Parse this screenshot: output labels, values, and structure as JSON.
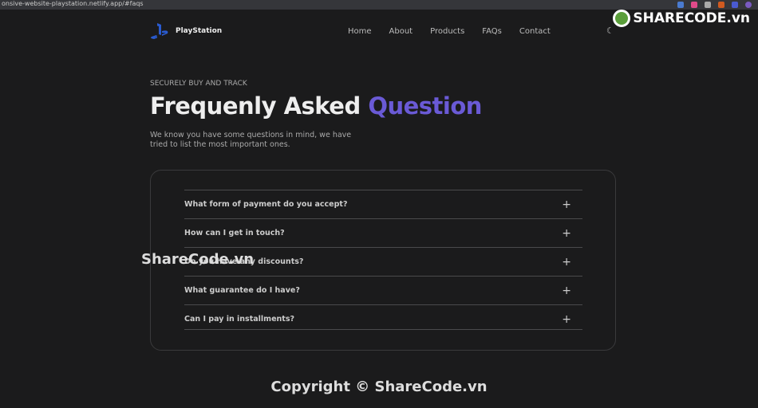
{
  "browser": {
    "url": "onsive-website-playstation.netlify.app/#faqs"
  },
  "nav": {
    "logo": "PlayStation",
    "items": [
      "Home",
      "About",
      "Products",
      "FAQs",
      "Contact"
    ],
    "theme_icon": "moon-icon"
  },
  "brand_watermark": "SHARECODE.vn",
  "hero": {
    "eyebrow": "SECURELY BUY AND TRACK",
    "title": "Frequenly Asked ",
    "title_accent": "Question",
    "accent_color": "#6a5ad6",
    "description": "We know you have some questions in mind, we have tried to list the most important ones."
  },
  "faqs": [
    {
      "question": "What form of payment do you accept?"
    },
    {
      "question": "How can I get in touch?"
    },
    {
      "question": "Do you have any discounts?"
    },
    {
      "question": "What guarantee do I have?"
    },
    {
      "question": "Can I pay in installments?"
    }
  ],
  "watermark": "ShareCode.vn",
  "copyright": "Copyright © ShareCode.vn"
}
